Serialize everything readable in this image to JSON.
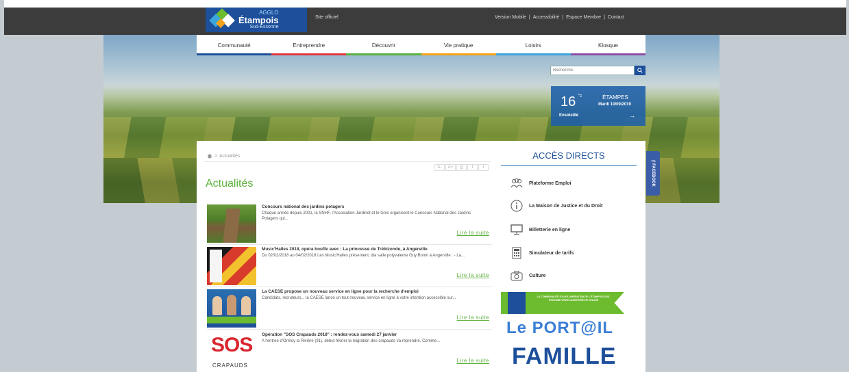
{
  "header": {
    "logo": {
      "line1": "AGGLO",
      "line2": "Étampois",
      "line3": "Sud-Essonne"
    },
    "site_label": "Site officiel",
    "links": [
      "Version Mobile",
      "Accessibilité",
      "Espace Membre",
      "Contact"
    ],
    "separator": "|"
  },
  "nav": {
    "items": [
      {
        "label": "Communauté",
        "color": "#1d4f9a"
      },
      {
        "label": "Entreprendre",
        "color": "#e2373f"
      },
      {
        "label": "Découvrir",
        "color": "#5bb13a"
      },
      {
        "label": "Vie pratique",
        "color": "#f2a31a"
      },
      {
        "label": "Loisirs",
        "color": "#3ba5dc"
      },
      {
        "label": "Kiosque",
        "color": "#8d4fa3"
      }
    ]
  },
  "search": {
    "placeholder": "Recherche"
  },
  "weather": {
    "temperature": "16",
    "unit": "°c",
    "city": "ÉTAMPES",
    "date": "Mardi 10/09/2019",
    "condition": "Ensoleillé",
    "arrow": "→"
  },
  "breadcrumb": {
    "home_icon": "home-icon",
    "separator": ">",
    "current": "Actualités"
  },
  "tools": [
    "A-",
    "A+",
    "⎙",
    "f",
    "t"
  ],
  "page_title": "Actualités",
  "news": [
    {
      "title": "Concours national des jardins potagers",
      "excerpt": "Chaque année depuis 2001, la SNHF, l'Association Jardinot et le Gnis organisent le Concours National des Jardins Potagers qui...",
      "more": "Lire la suite"
    },
    {
      "title": "Music'Halles 2018, opéra bouffe avec : La princesse de Trébizonde, à Angerville",
      "excerpt": "Du 02/02/2018 au 04/02/2018 Les Music'Halles présentent, dia salle polyvalente Guy Bonin à Angerville : - La...",
      "more": "Lire la suite"
    },
    {
      "title": "La CAESE propose un nouveau service en ligne pour la recherche d'emploi",
      "excerpt": "Candidats, recruteurs... la CAESE lance un tout nouveau service en ligne à votre intention accessible sur...",
      "more": "Lire la suite"
    },
    {
      "title": "Opération \"SOS Crapauds 2018\" : rendez-vous samedi 27 janvier",
      "excerpt": "A l'entrée d'Ormoy la Rivière (91), début février la migration des crapauds va reprendre. Comme...",
      "more": "Lire la suite",
      "thumb_text": "SOS",
      "thumb_sub": "CRAPAUDS"
    }
  ],
  "acces": {
    "title": "ACCÈS DIRECTS",
    "items": [
      {
        "label": "Plateforme Emploi",
        "icon": "people-icon"
      },
      {
        "label": "La Maison de Justice et du Droit",
        "icon": "info-icon"
      },
      {
        "label": "Billetterie en ligne",
        "icon": "monitor-icon"
      },
      {
        "label": "Simulateur de tarifs",
        "icon": "calculator-icon"
      },
      {
        "label": "Culture",
        "icon": "camera-icon"
      }
    ]
  },
  "facebook": {
    "label": "FACEBOOK",
    "icon": "f"
  },
  "banner": {
    "text": "LA COMMUNAUTÉ D'AGGLOMÉRATION DE L'ÉTAMPOIS SUD-ESSONNE WWW.CAESEDIRECTE.ONLINE",
    "portail": "Le PORT@IL",
    "famille": "FAMILLE"
  }
}
